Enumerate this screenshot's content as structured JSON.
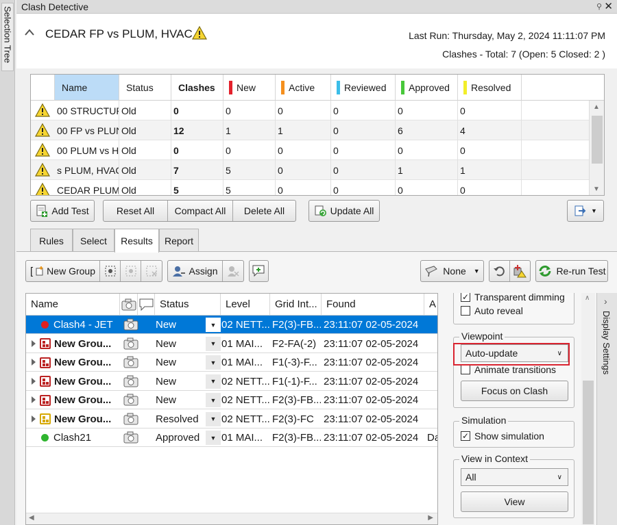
{
  "side_tab": {
    "label": "Selection Tree"
  },
  "window": {
    "title": "Clash Detective"
  },
  "header": {
    "test_title": "CEDAR FP vs PLUM, HVAC",
    "last_run": "Last Run:  Thursday, May 2, 2024 11:11:07 PM",
    "counts": "Clashes -  Total:  7  (Open:  5  Closed:  2 )"
  },
  "tests_table": {
    "columns": [
      "Name",
      "Status",
      "Clashes",
      "New",
      "Active",
      "Reviewed",
      "Approved",
      "Resolved"
    ],
    "status_colors": {
      "New": "#e3212c",
      "Active": "#f5901e",
      "Reviewed": "#3bbde8",
      "Approved": "#48c83a",
      "Resolved": "#f2ee2a"
    },
    "rows": [
      {
        "name": "00 STRUCTURI",
        "status": "Old",
        "clashes": "0",
        "new": "0",
        "active": "0",
        "reviewed": "0",
        "approved": "0",
        "resolved": "0"
      },
      {
        "name": "00 FP vs PLUN",
        "status": "Old",
        "clashes": "12",
        "new": "1",
        "active": "1",
        "reviewed": "0",
        "approved": "6",
        "resolved": "4"
      },
      {
        "name": "00 PLUM vs H",
        "status": "Old",
        "clashes": "0",
        "new": "0",
        "active": "0",
        "reviewed": "0",
        "approved": "0",
        "resolved": "0"
      },
      {
        "name": "s PLUM, HVAC",
        "status": "Old",
        "clashes": "7",
        "new": "5",
        "active": "0",
        "reviewed": "0",
        "approved": "1",
        "resolved": "1"
      },
      {
        "name": "CEDAR PLUM",
        "status": "Old",
        "clashes": "5",
        "new": "5",
        "active": "0",
        "reviewed": "0",
        "approved": "0",
        "resolved": "0"
      }
    ]
  },
  "test_buttons": {
    "add": "Add Test",
    "reset": "Reset All",
    "compact": "Compact All",
    "delete": "Delete All",
    "update": "Update All"
  },
  "tabs": [
    "Rules",
    "Select",
    "Results",
    "Report"
  ],
  "results_toolbar": {
    "new_group": "New Group",
    "assign": "Assign",
    "highlight": "None",
    "rerun": "Re-run Test"
  },
  "results": {
    "columns": [
      "Name",
      "Status",
      "Level",
      "Grid Int...",
      "Found",
      "A"
    ],
    "rows": [
      {
        "name": "Clash4 - JET",
        "status": "New",
        "level": "02 NETT...",
        "grid": "F2(3)-FB...",
        "found": "23:11:07 02-05-2024",
        "extra": ""
      },
      {
        "name": "New Grou...",
        "status": "New",
        "level": "01 MAI...",
        "grid": "F2-FA(-2)",
        "found": "23:11:07 02-05-2024",
        "extra": ""
      },
      {
        "name": "New Grou...",
        "status": "New",
        "level": "01 MAI...",
        "grid": "F1(-3)-F...",
        "found": "23:11:07 02-05-2024",
        "extra": ""
      },
      {
        "name": "New Grou...",
        "status": "New",
        "level": "02 NETT...",
        "grid": "F1(-1)-F...",
        "found": "23:11:07 02-05-2024",
        "extra": ""
      },
      {
        "name": "New Grou...",
        "status": "New",
        "level": "02 NETT...",
        "grid": "F2(3)-FB...",
        "found": "23:11:07 02-05-2024",
        "extra": ""
      },
      {
        "name": "New Grou...",
        "status": "Resolved",
        "level": "02 NETT...",
        "grid": "F2(3)-FC",
        "found": "23:11:07 02-05-2024",
        "extra": ""
      },
      {
        "name": "Clash21",
        "status": "Approved",
        "level": "01 MAI...",
        "grid": "F2(3)-FB...",
        "found": "23:11:07 02-05-2024",
        "extra": "Da"
      }
    ]
  },
  "settings": {
    "transparent_dimming": "Transparent dimming",
    "auto_reveal": "Auto reveal",
    "viewpoint_legend": "Viewpoint",
    "viewpoint_value": "Auto-update",
    "animate_transitions": "Animate transitions",
    "focus_button": "Focus on Clash",
    "simulation_legend": "Simulation",
    "show_simulation": "Show simulation",
    "context_legend": "View in Context",
    "context_value": "All",
    "view_button": "View",
    "panel_label": "Display Settings"
  }
}
